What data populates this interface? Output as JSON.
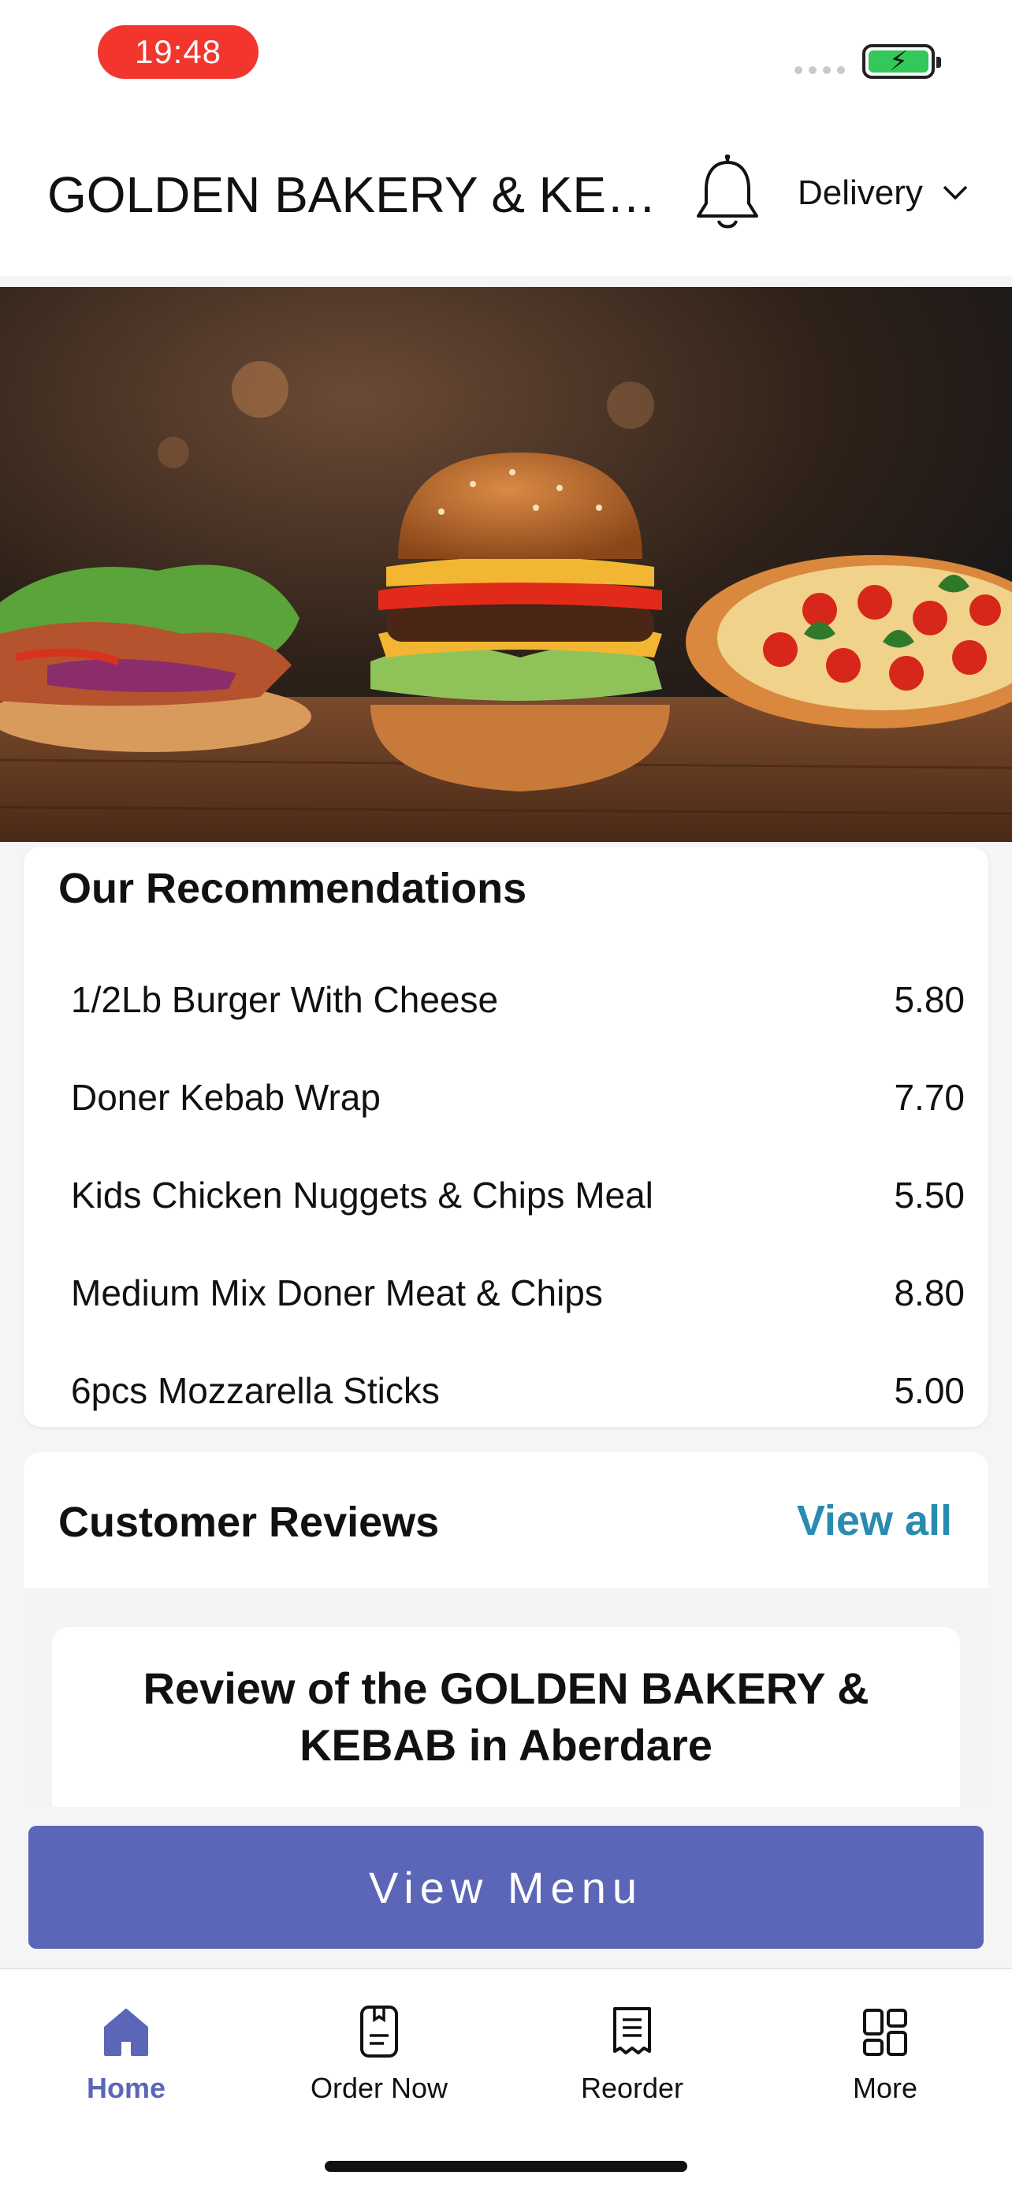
{
  "status_bar": {
    "time": "19:48"
  },
  "header": {
    "title": "GOLDEN BAKERY & KEB...",
    "bell_icon": "bell-icon",
    "delivery_label": "Delivery",
    "delivery_icon": "chevron-down-icon"
  },
  "recommendations": {
    "title": "Our Recommendations",
    "items": [
      {
        "name": "1/2Lb Burger With Cheese",
        "price": "5.80"
      },
      {
        "name": "Doner Kebab Wrap",
        "price": "7.70"
      },
      {
        "name": "Kids Chicken Nuggets & Chips Meal",
        "price": "5.50"
      },
      {
        "name": "Medium Mix Doner Meat & Chips",
        "price": "8.80"
      },
      {
        "name": "6pcs Mozzarella Sticks",
        "price": "5.00"
      }
    ]
  },
  "reviews": {
    "title": "Customer Reviews",
    "view_all": "View all",
    "card_title": "Review of the GOLDEN BAKERY & KEBAB in Aberdare"
  },
  "view_menu_label": "View Menu",
  "bottom_nav": [
    {
      "label": "Home",
      "icon": "home-icon",
      "active": true
    },
    {
      "label": "Order Now",
      "icon": "order-icon",
      "active": false
    },
    {
      "label": "Reorder",
      "icon": "receipt-icon",
      "active": false
    },
    {
      "label": "More",
      "icon": "grid-icon",
      "active": false
    }
  ],
  "colors": {
    "accent": "#5b66b9",
    "link": "#2a8bb0",
    "time_pill": "#f2362e",
    "battery": "#34c759"
  }
}
